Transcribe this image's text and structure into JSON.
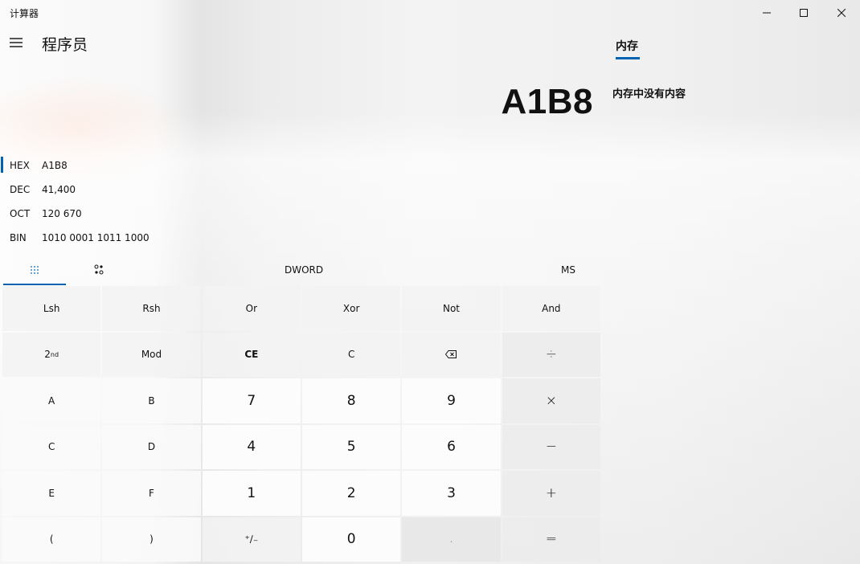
{
  "window": {
    "title": "计算器",
    "controls": {
      "minimize_icon": "minimize-icon",
      "maximize_icon": "maximize-icon",
      "close_icon": "close-icon"
    }
  },
  "header": {
    "menu_icon": "hamburger-menu-icon",
    "mode": "程序员"
  },
  "display": {
    "value": "A1B8"
  },
  "memory_panel": {
    "tab": "内存",
    "empty_message": "内存中没有内容"
  },
  "radix": {
    "selected": "HEX",
    "rows": [
      {
        "label": "HEX",
        "value": "A1B8"
      },
      {
        "label": "DEC",
        "value": "41,400"
      },
      {
        "label": "OCT",
        "value": "120 670"
      },
      {
        "label": "BIN",
        "value": "1010 0001 1011 1000"
      }
    ]
  },
  "toolbar": {
    "full_keypad_icon": "full-keypad-icon",
    "bit_toggling_icon": "bit-toggling-icon",
    "word_size": "DWORD",
    "memory_store": "MS"
  },
  "keypad": {
    "lsh": "Lsh",
    "rsh": "Rsh",
    "or": "Or",
    "xor": "Xor",
    "not": "Not",
    "and": "And",
    "second": "2",
    "second_sup": "nd",
    "mod": "Mod",
    "ce": "CE",
    "c": "C",
    "backspace_icon": "backspace-icon",
    "divide": "÷",
    "a": "A",
    "b": "B",
    "seven": "7",
    "eight": "8",
    "nine": "9",
    "multiply": "×",
    "hex_c": "C",
    "d": "D",
    "four": "4",
    "five": "5",
    "six": "6",
    "minus": "−",
    "e": "E",
    "f": "F",
    "one": "1",
    "two": "2",
    "three": "3",
    "plus": "+",
    "open_paren": "(",
    "close_paren": ")",
    "negate": "⁺∕₋",
    "zero": "0",
    "decimal": ".",
    "equals": "="
  },
  "colors": {
    "accent": "#0063b1"
  }
}
